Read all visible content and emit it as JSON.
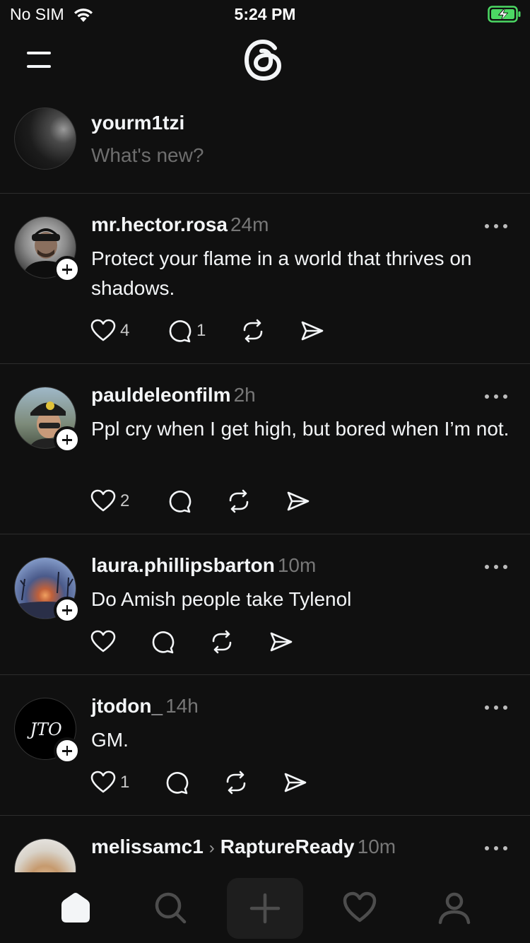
{
  "status_bar": {
    "carrier": "No SIM",
    "time": "5:24 PM",
    "battery_state": "charging"
  },
  "header": {
    "menu_icon": "menu-icon",
    "logo": "threads-logo"
  },
  "composer": {
    "username": "yourm1tzi",
    "placeholder": "What's new?"
  },
  "posts": [
    {
      "username": "mr.hector.rosa",
      "time": "24m",
      "text": "Protect your flame in a world that thrives on shadows.",
      "likes": "4",
      "replies": "1"
    },
    {
      "username": "pauldeleonfilm",
      "time": "2h",
      "text": "Ppl cry when I get high, but bored when I’m not.",
      "likes": "2",
      "replies": ""
    },
    {
      "username": "laura.phillipsbarton",
      "time": "10m",
      "text": "Do Amish people take Tylenol",
      "likes": "",
      "replies": ""
    },
    {
      "username": "jtodon_",
      "time": "14h",
      "text": "GM.",
      "likes": "1",
      "replies": ""
    },
    {
      "username": "melissamc1",
      "community": "RaptureReady",
      "time": "10m",
      "text": ""
    }
  ],
  "tab_bar": {
    "items": [
      "home-icon",
      "search-icon",
      "create-icon",
      "activity-icon",
      "profile-icon"
    ],
    "active": "home"
  },
  "colors": {
    "background": "#101010",
    "text": "#f3f5f7",
    "muted": "#777777",
    "divider": "#2d2d2d",
    "battery_green": "#4cd964"
  }
}
